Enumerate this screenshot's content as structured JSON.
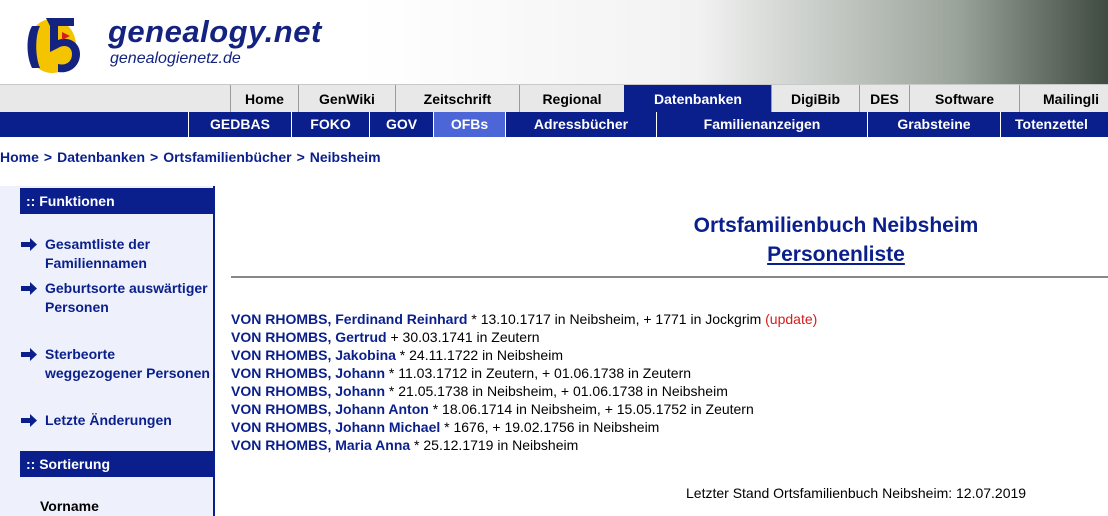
{
  "logo": {
    "title": "genealogy.net",
    "subtitle": "genealogienetz.de",
    "colors": {
      "brand_blue": "#13237f",
      "brand_yellow": "#f5c400"
    }
  },
  "nav_primary": [
    {
      "label": "Home",
      "active": false
    },
    {
      "label": "GenWiki",
      "active": false
    },
    {
      "label": "Zeitschrift",
      "active": false
    },
    {
      "label": "Regional",
      "active": false
    },
    {
      "label": "Datenbanken",
      "active": true
    },
    {
      "label": "DigiBib",
      "active": false
    },
    {
      "label": "DES",
      "active": false
    },
    {
      "label": "Software",
      "active": false
    },
    {
      "label": "Mailingli",
      "active": false
    }
  ],
  "nav_secondary": [
    {
      "label": "GEDBAS",
      "active": false
    },
    {
      "label": "FOKO",
      "active": false
    },
    {
      "label": "GOV",
      "active": false
    },
    {
      "label": "OFBs",
      "active": true
    },
    {
      "label": "Adressbücher",
      "active": false
    },
    {
      "label": "Familienanzeigen",
      "active": false
    },
    {
      "label": "Grabsteine",
      "active": false
    },
    {
      "label": "Totenzettel",
      "active": false
    }
  ],
  "breadcrumb": {
    "separator": ">",
    "items": [
      "Home",
      "Datenbanken",
      "Ortsfamilienbücher",
      "Neibsheim"
    ]
  },
  "sidebar": {
    "functions_heading": ":: Funktionen",
    "items": [
      {
        "label": "Gesamtliste der Familiennamen",
        "icon": "arrow-right-icon"
      },
      {
        "label": "Geburtsorte auswärtiger Personen",
        "icon": "arrow-right-icon"
      },
      {
        "label": "Sterbeorte weggezogener Personen",
        "icon": "arrow-right-icon"
      },
      {
        "label": "Letzte Änderungen",
        "icon": "arrow-right-icon"
      }
    ],
    "sort_heading": ":: Sortierung",
    "sort_items": [
      "Vorname"
    ]
  },
  "main": {
    "title": "Ortsfamilienbuch Neibsheim",
    "subtitle": "Personenliste",
    "persons": [
      {
        "name": "VON RHOMBS, Ferdinand Reinhard",
        "details": " * 13.10.1717 in Neibsheim, + 1771 in Jockgrim ",
        "update": "(update)"
      },
      {
        "name": "VON RHOMBS, Gertrud",
        "details": " + 30.03.1741 in Zeutern",
        "update": ""
      },
      {
        "name": "VON RHOMBS, Jakobina",
        "details": " * 24.11.1722 in Neibsheim",
        "update": ""
      },
      {
        "name": "VON RHOMBS, Johann",
        "details": " * 11.03.1712 in Zeutern, + 01.06.1738 in Zeutern",
        "update": ""
      },
      {
        "name": "VON RHOMBS, Johann",
        "details": " * 21.05.1738 in Neibsheim, + 01.06.1738 in Neibsheim",
        "update": ""
      },
      {
        "name": "VON RHOMBS, Johann Anton",
        "details": " * 18.06.1714 in Neibsheim, + 15.05.1752 in Zeutern",
        "update": ""
      },
      {
        "name": "VON RHOMBS, Johann Michael",
        "details": " * 1676, + 19.02.1756 in Neibsheim",
        "update": ""
      },
      {
        "name": "VON RHOMBS, Maria Anna",
        "details": " * 25.12.1719 in Neibsheim",
        "update": ""
      }
    ],
    "footer_note": "Letzter Stand Ortsfamilienbuch Neibsheim: 12.07.2019"
  },
  "colors": {
    "nav_blue": "#0a1f8c",
    "active_sub": "#4c66d8",
    "update_red": "#d61c1c"
  }
}
